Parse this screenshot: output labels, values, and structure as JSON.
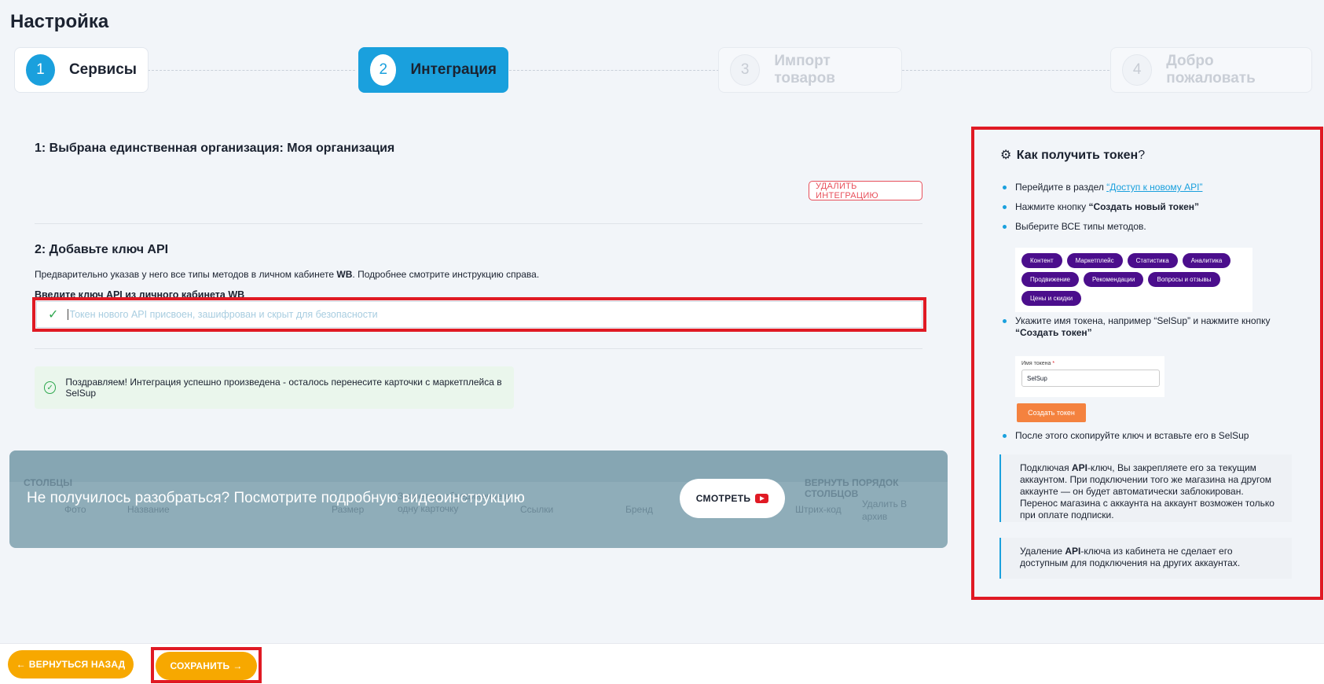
{
  "page": {
    "title": "Настройка"
  },
  "stepper": {
    "steps": [
      {
        "num": "1",
        "label": "Сервисы",
        "state": "done"
      },
      {
        "num": "2",
        "label": "Интеграция",
        "state": "active"
      },
      {
        "num": "3",
        "label": "Импорт товаров",
        "state": "pending"
      },
      {
        "num": "4",
        "label": "Добро пожаловать",
        "state": "pending"
      }
    ]
  },
  "section1": {
    "title": "1: Выбрана единственная организация: Моя организация",
    "delete_button": "УДАЛИТЬ ИНТЕГРАЦИЮ"
  },
  "section2": {
    "title": "2: Добавьте ключ API",
    "desc_prefix": "Предварительно указав у него все типы методов в личном кабинете ",
    "desc_wb": "WB",
    "desc_suffix": ". Подробнее смотрите инструкцию справа.",
    "field_label": "Введите ключ API из личного кабинета WB",
    "token_placeholder": "Токен нового API присвоен, зашифрован и скрыт для безопасности",
    "success_text": "Поздравляем! Интеграция успешно произведена - осталось перенесите карточки с маркетплейса в SelSup"
  },
  "banner": {
    "headline": "Не получилось разобраться? Посмотрите подробную видеоинструкцию",
    "watch_button": "СМОТРЕТЬ",
    "ghost": {
      "columns_label": "СТОЛБЦЫ",
      "restore_label": "ВЕРНУТЬ ПОРЯДОК СТОЛБЦОВ",
      "headers": [
        "Фото",
        "Название",
        "Размер",
        "Запрет на объединение в одну карточку",
        "Ссылки",
        "Бренд",
        "Штрих-код",
        "Удалить В архив"
      ]
    }
  },
  "help": {
    "title": "Как получить токен",
    "title_q": "?",
    "step1_text": "Перейдите в раздел ",
    "step1_link": "“Доступ к новому API”",
    "step2_text": "Нажмите кнопку ",
    "step2_bold": "“Создать новый токен”",
    "step3_text": "Выберите ВСЕ типы методов.",
    "tags": [
      "Контент",
      "Маркетплейс",
      "Статистика",
      "Аналитика",
      "Продвижение",
      "Рекомендации",
      "Вопросы и отзывы",
      "Цены и скидки"
    ],
    "step4_text": "Укажите имя токена, например “SelSup” и нажмите кнопку ",
    "step4_bold": "“Создать токен”",
    "token_name_label": "Имя токена",
    "token_name_value": "SelSup",
    "create_button": "Создать токен",
    "step5_text": "После этого скопируйте ключ и вставьте его в SelSup",
    "note1_prefix": "Подключая ",
    "note1_api": "API",
    "note1_rest": "-ключ, Вы закрепляете его за текущим аккаунтом. При подключении того же магазина на другом аккаунте — он будет автоматически заблокирован. Перенос магазина с аккаунта на аккаунт возможен только при оплате подписки.",
    "note2_prefix": "Удаление ",
    "note2_api": "API",
    "note2_rest": "-ключа из кабинета не сделает его доступным для подключения на других аккаунтах."
  },
  "footer": {
    "back_button": "ВЕРНУТЬСЯ НАЗАД",
    "save_button": "СОХРАНИТЬ"
  },
  "colors": {
    "accent": "#1aa0dd",
    "orange": "#f7a800",
    "highlight": "#e01a24",
    "tag": "#4b0e8c"
  }
}
